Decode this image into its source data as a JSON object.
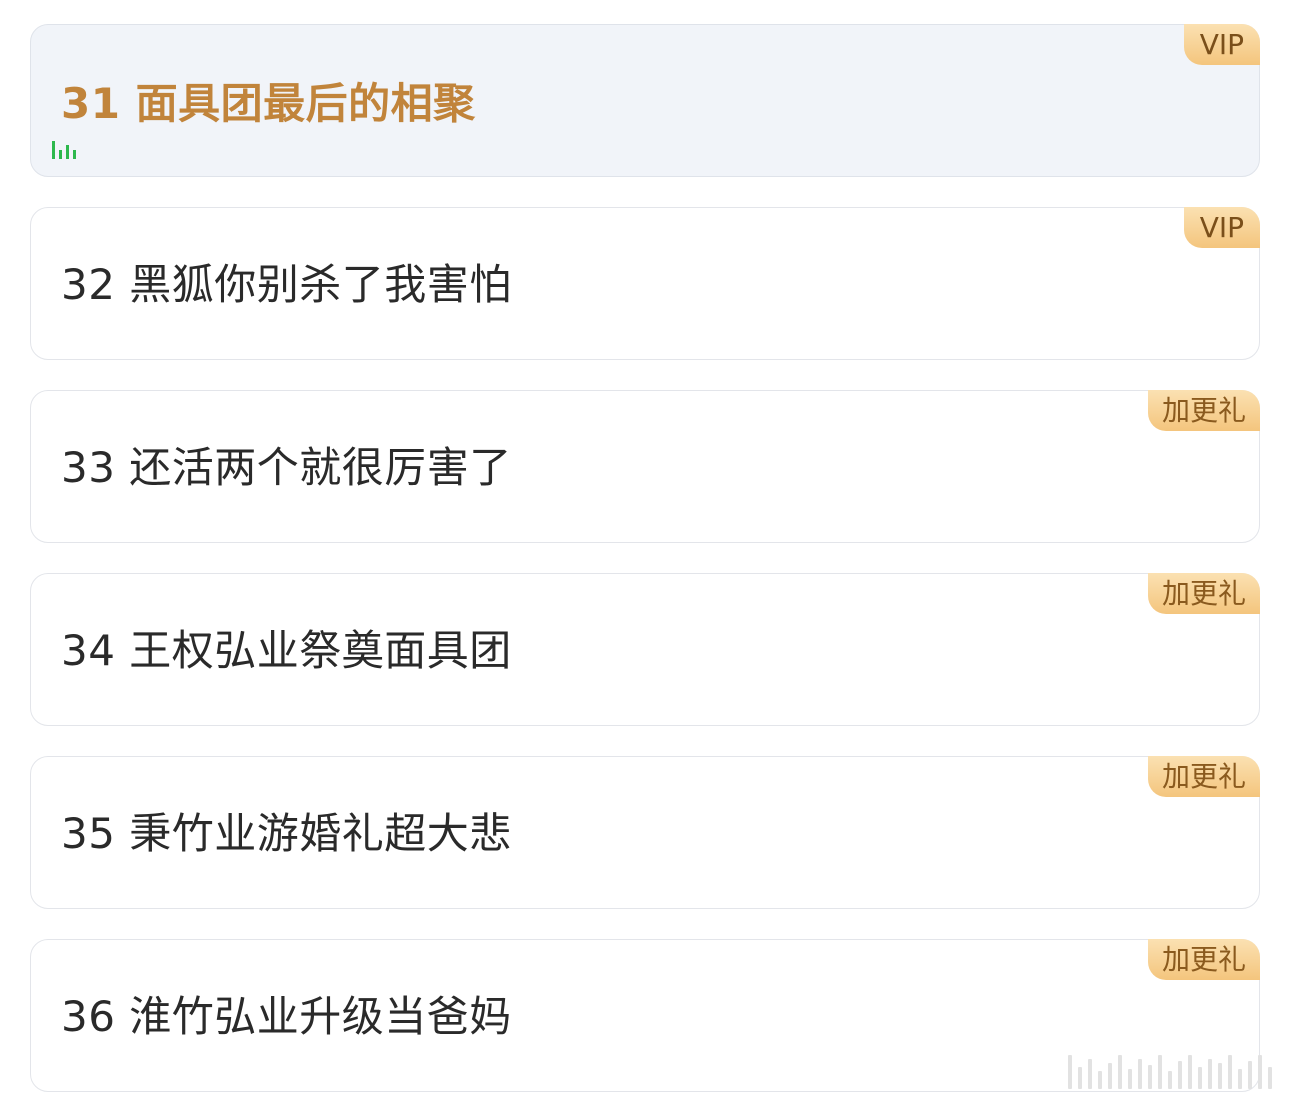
{
  "episodes": [
    {
      "title": "31 面具团最后的相聚",
      "tag": "VIP",
      "active": true
    },
    {
      "title": "32 黑狐你别杀了我害怕",
      "tag": "VIP",
      "active": false
    },
    {
      "title": "33 还活两个就很厉害了",
      "tag": "加更礼",
      "active": false
    },
    {
      "title": "34 王权弘业祭奠面具团",
      "tag": "加更礼",
      "active": false
    },
    {
      "title": "35 秉竹业游婚礼超大悲",
      "tag": "加更礼",
      "active": false
    },
    {
      "title": "36 淮竹弘业升级当爸妈",
      "tag": "加更礼",
      "active": false
    }
  ],
  "colors": {
    "active_title": "#c1843b",
    "playing_indicator": "#2db84d",
    "tag_gradient_top": "#fbe1b2",
    "tag_gradient_bottom": "#f4c57d"
  },
  "icons": {
    "playing": "playing-bars-icon",
    "watermark": "watermark-icon"
  }
}
